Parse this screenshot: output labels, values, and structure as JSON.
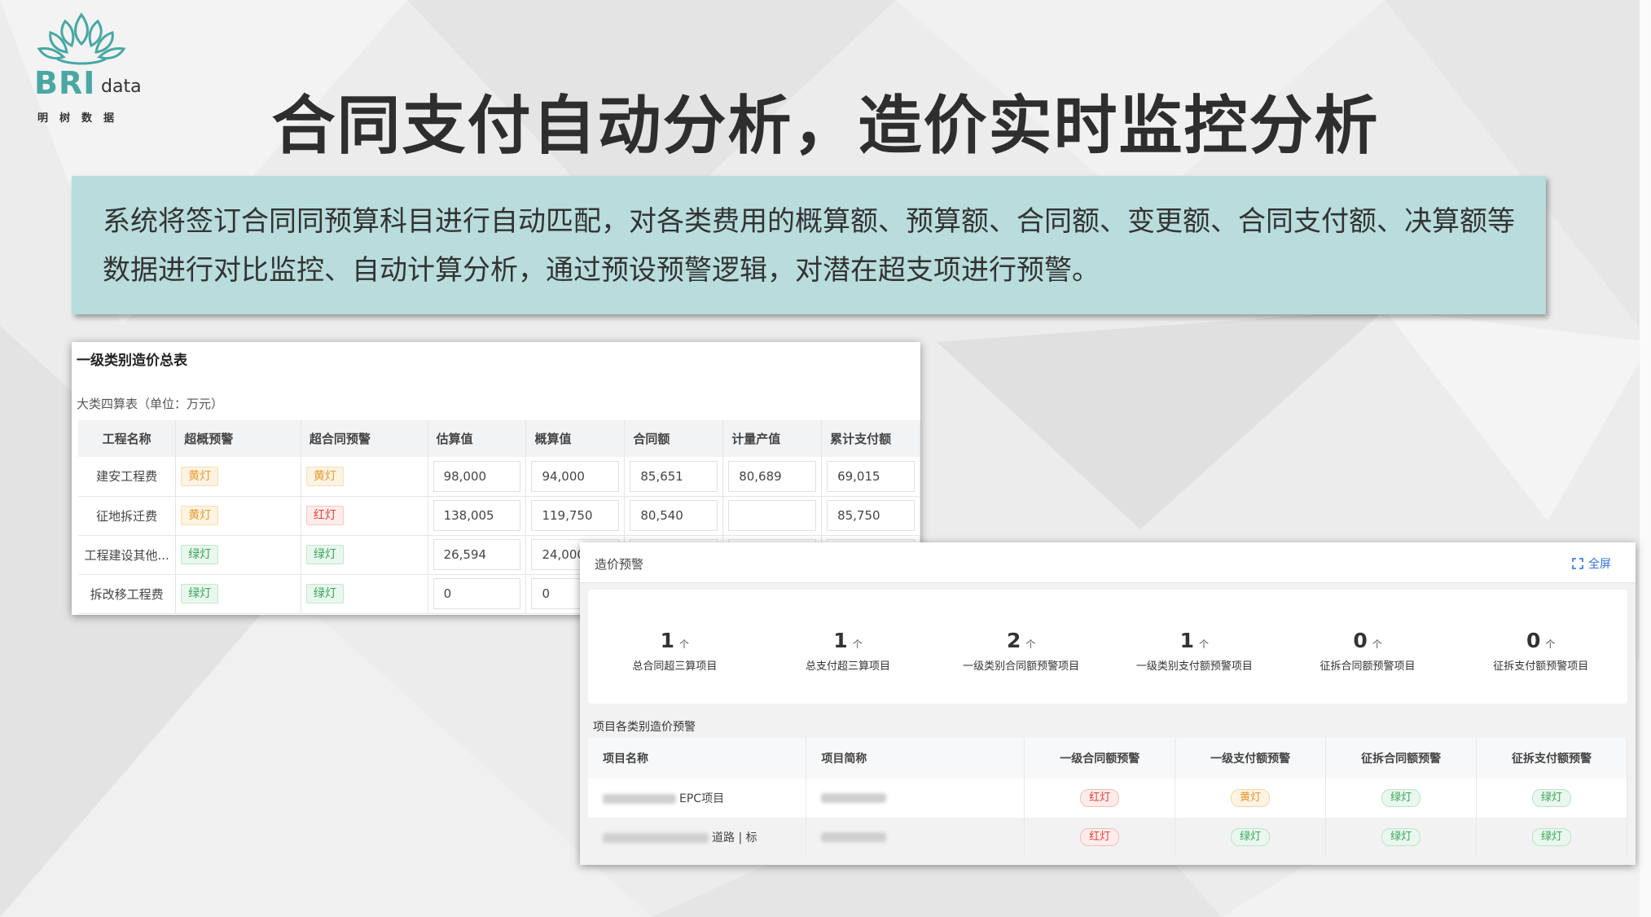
{
  "brand": {
    "logo_text": "BRI",
    "logo_suffix": "data",
    "logo_cn": "明树数据"
  },
  "title": "合同支付自动分析，造价实时监控分析",
  "description": "系统将签订合同同预算科目进行自动匹配，对各类费用的概算额、预算额、合同额、变更额、合同支付额、决算额等数据进行对比监控、自动计算分析，通过预设预警逻辑，对潜在超支项进行预警。",
  "summary_table": {
    "title": "一级类别造价总表",
    "subtitle": "大类四算表（单位：万元）",
    "headers": [
      "工程名称",
      "超概预警",
      "超合同预警",
      "估算值",
      "概算值",
      "合同额",
      "计量产值",
      "累计支付额"
    ],
    "rows": [
      {
        "name": "建安工程费",
        "over_estimate": "黄灯",
        "over_contract": "黄灯",
        "estimate": "98,000",
        "budget": "94,000",
        "contract": "85,651",
        "measured": "80,689",
        "paid": "69,015"
      },
      {
        "name": "征地拆迁费",
        "over_estimate": "黄灯",
        "over_contract": "红灯",
        "estimate": "138,005",
        "budget": "119,750",
        "contract": "80,540",
        "measured": "",
        "paid": "85,750"
      },
      {
        "name": "工程建设其他...",
        "over_estimate": "绿灯",
        "over_contract": "绿灯",
        "estimate": "26,594",
        "budget": "24,000",
        "contract": "",
        "measured": "",
        "paid": ""
      },
      {
        "name": "拆改移工程费",
        "over_estimate": "绿灯",
        "over_contract": "绿灯",
        "estimate": "0",
        "budget": "0",
        "contract": "",
        "measured": "",
        "paid": ""
      }
    ]
  },
  "warning_panel": {
    "title": "造价预警",
    "fullscreen_label": "全屏",
    "stats": [
      {
        "value": "1",
        "unit": "个",
        "label": "总合同超三算项目"
      },
      {
        "value": "1",
        "unit": "个",
        "label": "总支付超三算项目"
      },
      {
        "value": "2",
        "unit": "个",
        "label": "一级类别合同额预警项目"
      },
      {
        "value": "1",
        "unit": "个",
        "label": "一级类别支付额预警项目"
      },
      {
        "value": "0",
        "unit": "个",
        "label": "征拆合同额预警项目"
      },
      {
        "value": "0",
        "unit": "个",
        "label": "征拆支付额预警项目"
      }
    ],
    "table_title": "项目各类别造价预警",
    "headers": [
      "项目名称",
      "项目简称",
      "一级合同额预警",
      "一级支付额预警",
      "征拆合同额预警",
      "征拆支付额预警"
    ],
    "rows": [
      {
        "name_suffix": "EPC项目",
        "w1": "红灯",
        "w2": "黄灯",
        "w3": "绿灯",
        "w4": "绿灯"
      },
      {
        "name_suffix": "道路 | 标",
        "w1": "红灯",
        "w2": "绿灯",
        "w3": "绿灯",
        "w4": "绿灯"
      }
    ]
  },
  "colors": {
    "accent_teal": "#4aa7a3",
    "desc_bg": "#b9dcdc",
    "red": "#e0443c",
    "yellow": "#e69a2e",
    "green": "#3aa55a",
    "link_blue": "#2f6fd6"
  }
}
